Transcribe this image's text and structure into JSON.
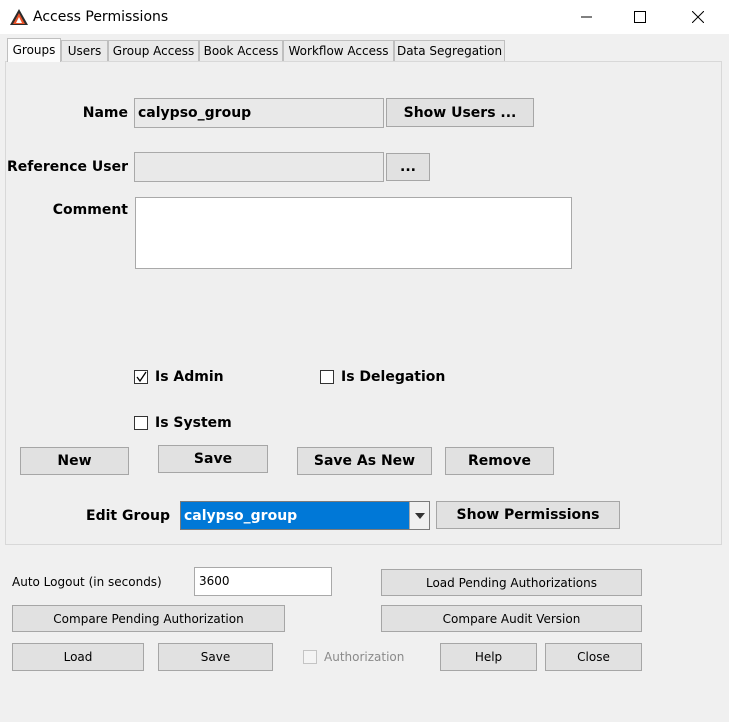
{
  "window": {
    "title": "Access Permissions"
  },
  "tabs": [
    {
      "label": "Groups"
    },
    {
      "label": "Users"
    },
    {
      "label": "Group Access"
    },
    {
      "label": "Book Access"
    },
    {
      "label": "Workflow Access"
    },
    {
      "label": "Data Segregation"
    }
  ],
  "groups": {
    "name_label": "Name",
    "name_value": "calypso_group",
    "show_users_label": "Show Users ...",
    "reference_user_label": "Reference User",
    "reference_user_value": "",
    "ellipsis_label": "...",
    "comment_label": "Comment",
    "comment_value": "",
    "is_admin_label": "Is Admin",
    "is_admin_checked": true,
    "is_delegation_label": "Is Delegation",
    "is_delegation_checked": false,
    "is_system_label": "Is System",
    "is_system_checked": false,
    "new_label": "New",
    "save_label": "Save",
    "save_as_new_label": "Save As New",
    "remove_label": "Remove",
    "edit_group_label": "Edit Group",
    "edit_group_value": "calypso_group",
    "show_permissions_label": "Show Permissions"
  },
  "footer": {
    "auto_logout_label": "Auto Logout (in seconds)",
    "auto_logout_value": "3600",
    "load_pending_label": "Load Pending Authorizations",
    "compare_pending_label": "Compare Pending Authorization",
    "compare_audit_label": "Compare Audit Version",
    "load_label": "Load",
    "save_label": "Save",
    "authorization_label": "Authorization",
    "authorization_checked": false,
    "help_label": "Help",
    "close_label": "Close"
  },
  "colors": {
    "selected_bg": "#0078d7",
    "logo_orange": "#e8532a",
    "logo_dark": "#2b2b2b"
  }
}
